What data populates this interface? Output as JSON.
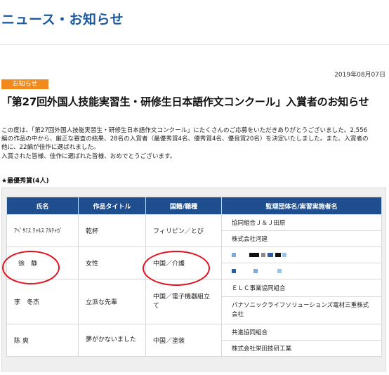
{
  "header": {
    "title": "ニュース・お知らせ"
  },
  "article": {
    "date": "2019年08月07日",
    "badge": "お知らせ",
    "title": "「第27回外国人技能実習生・研修生日本語作文コンクール」入賞者のお知らせ",
    "body_lines": [
      "この度は、「第27回外国人技能実習生・研修生日本語作文コンクール」にたくさんのご応募をいただきありがとうございました。2,556",
      "編の作品の中から、厳正な審査の結果、28名の入賞者（最優秀賞4名、優秀賞4名、優良賞20名）を決定いたしました。また、入賞者の",
      "他に、22編が佳作に選ばれました。",
      "入賞された皆様、佳作に選ばれた皆様、おめでとうございます。"
    ],
    "section_label": "★最優秀賞(4人)"
  },
  "table": {
    "headers": [
      "氏名",
      "作品タイトル",
      "国籍/職種",
      "監理団体名/実習実施者名"
    ],
    "rows": [
      {
        "name": "ｱﾍﾞｻﾐｽ ﾁｬﾙｽ ｱﾙﾁｬｶﾞ",
        "title": "乾杯",
        "country": "フィリピン／とび",
        "orgs": [
          "協同組合Ｊ＆Ｊ田原",
          "株式会社河建"
        ]
      },
      {
        "name": "徐　静",
        "title": "女性",
        "country": "中国／介護",
        "orgs": [
          "",
          ""
        ]
      },
      {
        "name": "李　冬杰",
        "title": "立派な先輩",
        "country": "中国／電子機器組立て",
        "orgs": [
          "ＥＬＣ事業協同組合",
          "パナソニックライフソリューションズ電材三重株式会社"
        ]
      },
      {
        "name": "陈 爽",
        "title": "夢がかないました",
        "country": "中国／塗装",
        "orgs": [
          "共進協同組合",
          "株式会社栄田技研工業"
        ]
      }
    ]
  },
  "colors": {
    "header_blue": "#1a5a9f",
    "table_header": "#1f4e8e",
    "badge_orange": "#f08a1c",
    "annotation_red": "#e1111d"
  }
}
